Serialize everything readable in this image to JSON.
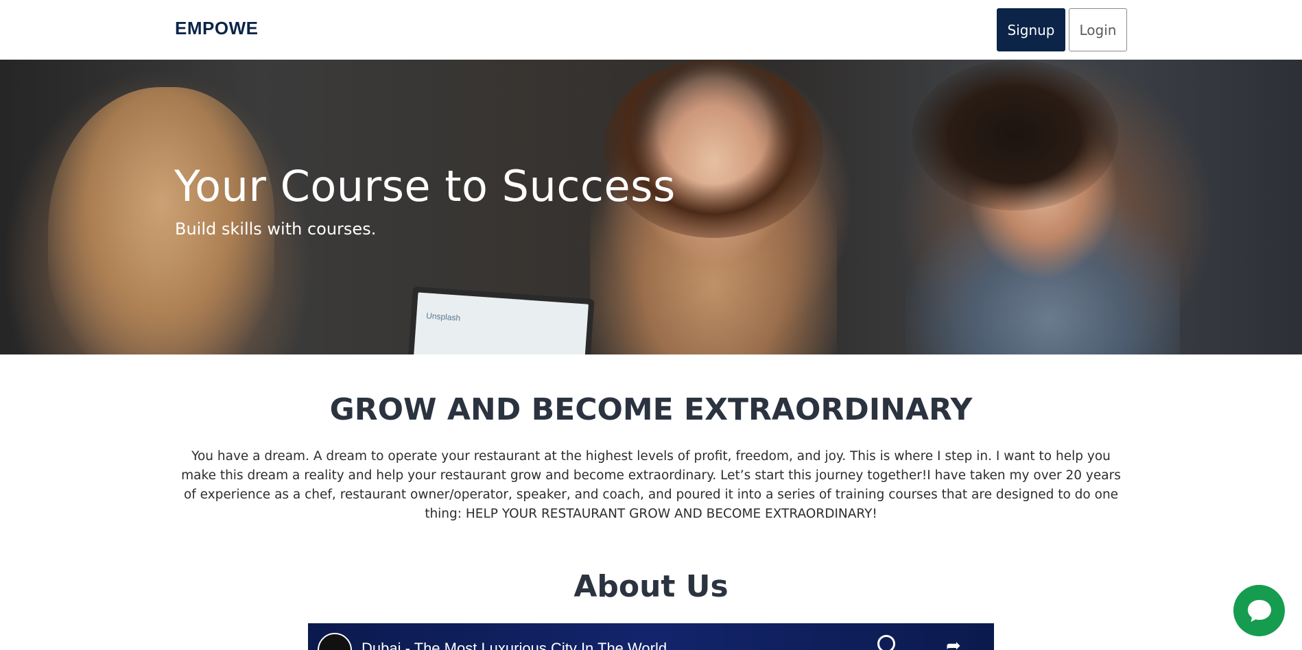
{
  "header": {
    "brand": "EMPOWE",
    "signup_label": "Signup",
    "login_label": "Login"
  },
  "hero": {
    "title": "Your Course to Success",
    "subtitle": "Build skills with courses.",
    "laptop_text": "Unsplash"
  },
  "section": {
    "title": "GROW AND BECOME EXTRAORDINARY",
    "text": "You have a dream. A dream to operate your restaurant at the highest levels of profit, freedom, and joy. This is where I step in. I want to help you make this dream a reality and help your restaurant grow and become extraordinary. Let’s start this journey together!I have taken my over 20 years of experience as a chef, restaurant owner/operator, speaker, and coach, and poured it into a series of training courses that are designed to do one thing: HELP YOUR RESTAURANT GROW AND BECOME EXTRAORDINARY!"
  },
  "about": {
    "title": "About Us",
    "video_title": "Dubai - The Most Luxurious City In The World"
  },
  "colors": {
    "brand": "#0b2447",
    "chat": "#169c4f"
  },
  "icons": {
    "chat": "chat-bubble-icon",
    "clock": "clock-icon",
    "share": "share-icon"
  }
}
